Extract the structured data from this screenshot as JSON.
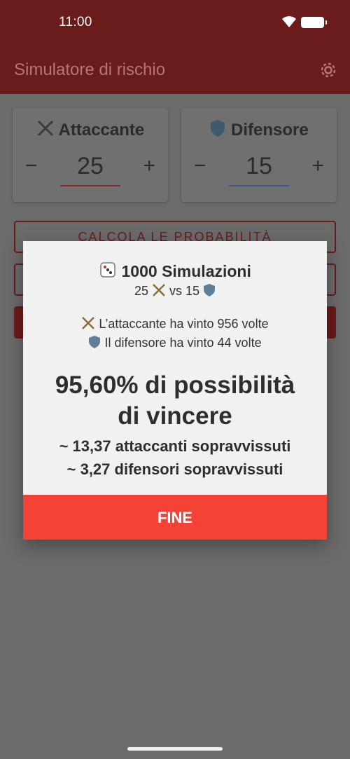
{
  "status_bar": {
    "time": "11:00"
  },
  "app_bar": {
    "title": "Simulatore di rischio"
  },
  "attacker": {
    "label": "Attaccante",
    "value": "25",
    "minus": "−",
    "plus": "+"
  },
  "defender": {
    "label": "Difensore",
    "value": "15",
    "minus": "−",
    "plus": "+"
  },
  "buttons": {
    "calculate": "CALCOLA LE PROBABILITÀ"
  },
  "dialog": {
    "title": "1000 Simulazioni",
    "matchup_attack": "25",
    "matchup_vs": "vs 15",
    "attacker_wins": "L’attaccante ha vinto 956 volte",
    "defender_wins": "Il difensore ha vinto 44 volte",
    "win_chance_line1": "95,60% di possibilità",
    "win_chance_line2": "di vincere",
    "attackers_survived": "~ 13,37 attaccanti sopravvissuti",
    "defenders_survived": "~ 3,27 difensori sopravvissuti",
    "close_button": "FINE"
  },
  "colors": {
    "primary": "#6a1c1a",
    "accent_button": "#f44336",
    "dialog_bg": "#f1f1f1",
    "scrim_bg": "#6b6b6b",
    "attacker_underline": "#8b2a28",
    "defender_underline": "#3a5f8a"
  },
  "icons": {
    "attacker": "crossed-swords-icon",
    "defender": "shield-icon",
    "dice": "dice-icon",
    "settings": "gear-icon",
    "wifi": "wifi-icon",
    "battery": "battery-icon"
  }
}
